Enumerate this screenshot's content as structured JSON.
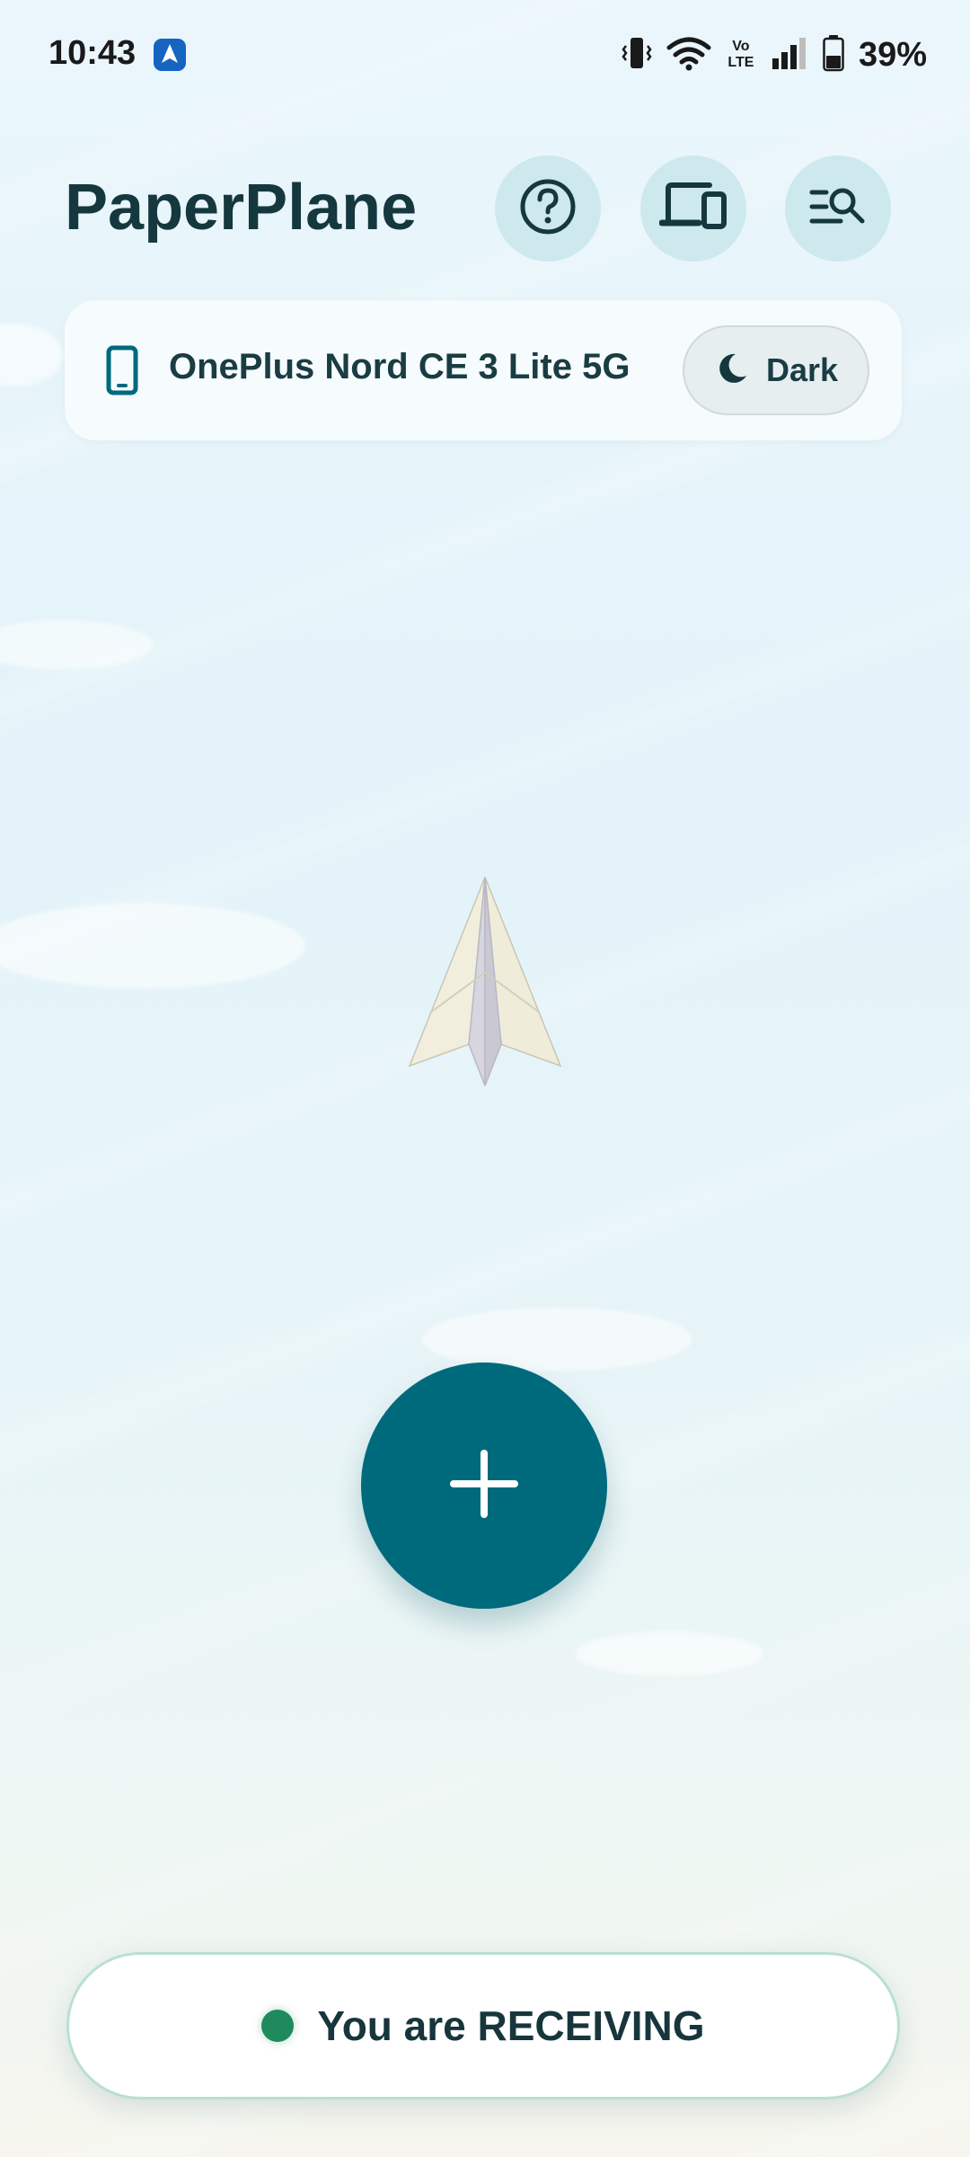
{
  "status_bar": {
    "time": "10:43",
    "battery_percent": "39%",
    "network_label": "Vo LTE",
    "icons": [
      "navigation-app-icon",
      "vibrate-icon",
      "wifi-icon",
      "volte-icon",
      "signal-icon",
      "battery-icon"
    ]
  },
  "header": {
    "title": "PaperPlane",
    "buttons": [
      "help-icon",
      "devices-icon",
      "search-list-icon"
    ]
  },
  "device_card": {
    "device_name": "OnePlus Nord CE 3 Lite 5G",
    "theme_toggle_label": "Dark",
    "icons": [
      "phone-icon",
      "moon-icon"
    ]
  },
  "fab": {
    "icon": "plus-icon"
  },
  "receive_status": {
    "text": "You are RECEIVING",
    "dot_color": "#1f8a5b"
  },
  "colors": {
    "accent": "#006a7d",
    "header_button_bg": "#cde9ee",
    "title_text": "#15383e"
  }
}
